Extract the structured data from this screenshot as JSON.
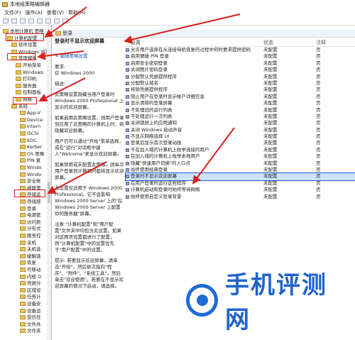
{
  "window": {
    "title": "本地组策略编辑器"
  },
  "menu": [
    "文件(F)",
    "操作(A)",
    "查看(V)",
    "帮助(H)"
  ],
  "tree": [
    {
      "label": "本地计算机 策略",
      "indent": 0
    },
    {
      "label": "计算机配置",
      "indent": 1
    },
    {
      "label": "软件设置",
      "indent": 2
    },
    {
      "label": "Windows 设置",
      "indent": 2
    },
    {
      "label": "管理模板",
      "indent": 2
    },
    {
      "label": "开始菜单",
      "indent": 3
    },
    {
      "label": "Windows",
      "indent": 3
    },
    {
      "label": "打印机",
      "indent": 3
    },
    {
      "label": "服务器",
      "indent": 3
    },
    {
      "label": "控制面板",
      "indent": 3
    },
    {
      "label": "网络",
      "indent": 3
    },
    {
      "label": "系统",
      "indent": 2
    },
    {
      "label": "App-V",
      "indent": 4
    },
    {
      "label": "Device",
      "indent": 4
    },
    {
      "label": "Intern",
      "indent": 4
    },
    {
      "label": "iSCSI",
      "indent": 4
    },
    {
      "label": "KDC",
      "indent": 4
    },
    {
      "label": "Kerber",
      "indent": 4
    },
    {
      "label": "OS 策略",
      "indent": 4
    },
    {
      "label": "PIN 复",
      "indent": 4
    },
    {
      "label": "Windo",
      "indent": 4
    },
    {
      "label": "Windo",
      "indent": 4
    },
    {
      "label": "安全帐",
      "indent": 4
    },
    {
      "label": "被政策",
      "indent": 4
    },
    {
      "label": "存储运",
      "indent": 4
    },
    {
      "label": "存储感",
      "indent": 4
    },
    {
      "label": "登录",
      "indent": 4
    },
    {
      "label": "电源管",
      "indent": 4
    },
    {
      "label": "访问拒",
      "indent": 4
    },
    {
      "label": "分布式",
      "indent": 4
    },
    {
      "label": "服务控",
      "indent": 4
    },
    {
      "label": "关机",
      "indent": 4
    },
    {
      "label": "关机选",
      "indent": 4
    },
    {
      "label": "缓解选",
      "indent": 4
    },
    {
      "label": "恢复",
      "indent": 4
    },
    {
      "label": "可移动",
      "indent": 4
    },
    {
      "label": "内核 D",
      "indent": 4
    },
    {
      "label": "凭据分",
      "indent": 4
    },
    {
      "label": "区域设",
      "indent": 4
    },
    {
      "label": "任务计",
      "indent": 4
    },
    {
      "label": "设备安",
      "indent": 4
    },
    {
      "label": "设备运",
      "indent": 4
    },
    {
      "label": "受信任",
      "indent": 4
    },
    {
      "label": "文件共",
      "indent": 4
    },
    {
      "label": "文件夹",
      "indent": 4
    }
  ],
  "header": {
    "title": "登录"
  },
  "description": {
    "title": "登录时不显示欢迎屏幕",
    "edit_link": "编辑策略设置",
    "req_label": "要求:",
    "req_value": "仅 Windows 2000",
    "desc_label": "描述:",
    "p1": "此策略设置隐藏当用户登录时 Windows 2000 Professional 上显示的欢迎屏幕。",
    "p2": "如果启用此策略设置，则用户登录到应用了此策略的计算机上时，将隐藏欢迎屏幕。",
    "p3": "用户仍可以通过\"开始\"菜单选择，或在\"运行\"对话框中键入\"Welcome\"来显示欢迎屏幕。",
    "p4": "如果禁用或未配置此策略，则每次用户登录到计算机时都将显示欢迎屏幕。",
    "p5": "此设置仅适用于 Windows 2000 Professional。它不会影响 Windows 2000 Server 上的\"在 Windows 2000 Server 上配置你的服务器\"屏幕。",
    "p6": "注意:\"计算机配置\"和\"用户配置\"文件夹中均包含此设置。如果对这两项设置都进行了配置，则\"计算机配置\"中的设置优先于\"用户配置\"中的设置。",
    "p7": "提示: 若要显示欢迎屏幕，请单击\"开始\"，然后依次指向\"程序\"、\"附件\"、\"系统工具\"，然后单击\"欢迎使用\"。若要在不显示欢迎屏幕的情况下启动，请选择。"
  },
  "list": {
    "headers": {
      "name": "设置",
      "state": "状态",
      "note": "注释"
    },
    "rows": [
      {
        "name": "允许用户选择在从连接待机恢复的过程中何时要求提供密码",
        "state": "未配置",
        "note": "否"
      },
      {
        "name": "启用便捷 PIN 登录",
        "state": "未配置",
        "note": "否"
      },
      {
        "name": "启用安全密钥登录",
        "state": "未配置",
        "note": "否"
      },
      {
        "name": "关闭图片密码登录",
        "state": "未配置",
        "note": "否"
      },
      {
        "name": "分配默认凭据提供程序",
        "state": "未配置",
        "note": "否"
      },
      {
        "name": "分配默认域名",
        "state": "未配置",
        "note": "否"
      },
      {
        "name": "排除凭据提供程序",
        "state": "未配置",
        "note": "否"
      },
      {
        "name": "阻止用户在登录时显示帐户详细信息",
        "state": "未配置",
        "note": "否"
      },
      {
        "name": "显示清除的登录屏幕",
        "state": "未配置",
        "note": "否"
      },
      {
        "name": "不处理旧的运行列表",
        "state": "未配置",
        "note": "否"
      },
      {
        "name": "不处理运行一次列表",
        "state": "未配置",
        "note": "否"
      },
      {
        "name": "关闭锁屏上的应用通知",
        "state": "未配置",
        "note": "否"
      },
      {
        "name": "关闭 Windows 启动声音",
        "state": "未配置",
        "note": "否"
      },
      {
        "name": "不显示网络选择 UI",
        "state": "未配置",
        "note": "否"
      },
      {
        "name": "登录后显示首次登录动画",
        "state": "未配置",
        "note": "否"
      },
      {
        "name": "不在加入域的计算机上枚举连接的用户",
        "state": "未配置",
        "note": "否"
      },
      {
        "name": "在加入域的计算机上枚举本地用户",
        "state": "未配置",
        "note": "否"
      },
      {
        "name": "隐藏\"快速用户切换\"的入口点",
        "state": "未配置",
        "note": "否"
      },
      {
        "name": "始终使用经典登录",
        "state": "未配置",
        "note": "否"
      },
      {
        "name": "登录时不显示欢迎屏幕",
        "state": "未配置",
        "note": "否",
        "selected": true
      },
      {
        "name": "在用户登录时运行这些程序",
        "state": "未配置",
        "note": "否"
      },
      {
        "name": "计算机启动和登录时始终等待网络",
        "state": "未配置",
        "note": "否"
      },
      {
        "name": "始终使用自定义登录背景",
        "state": "未配置",
        "note": "否"
      }
    ]
  },
  "watermark": {
    "text": "手机评测网"
  },
  "colors": {
    "accent": "#1e5ad6",
    "annotation": "#d8201c",
    "watermark": "#1f63cc"
  }
}
